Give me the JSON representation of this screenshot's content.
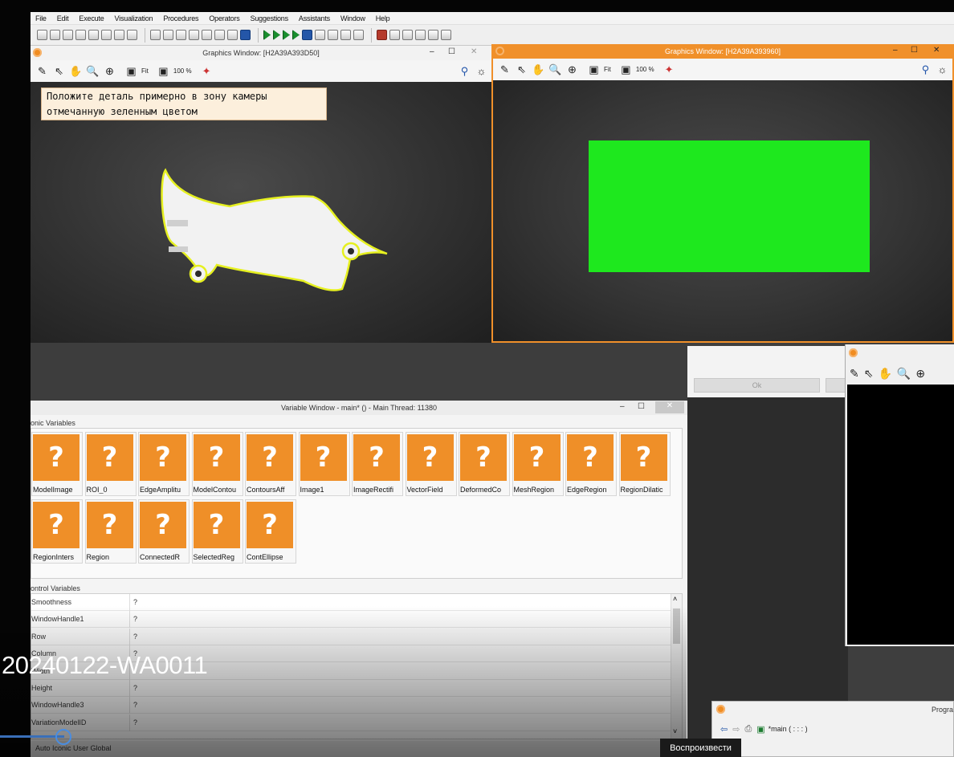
{
  "menu": [
    "File",
    "Edit",
    "Execute",
    "Visualization",
    "Procedures",
    "Operators",
    "Suggestions",
    "Assistants",
    "Window",
    "Help"
  ],
  "graphics_left": {
    "title": "Graphics Window: [H2A39A393D50]",
    "fit_label": "Fit",
    "zoom_label": "100 %",
    "message": "Положите деталь примерно в зону камеры отмечанную зеленным цветом"
  },
  "graphics_right": {
    "title": "Graphics Window: [H2A39A393960]",
    "fit_label": "Fit",
    "zoom_label": "100 %",
    "title_color": "#f0902a"
  },
  "dialog": {
    "ok_label": "Ok"
  },
  "variable_window": {
    "title": "Variable Window - main* () - Main Thread: 11380",
    "iconic_label": "Iconic Variables",
    "iconic_label_visible": "onic Variables",
    "iconic_vars": [
      "ModelImage",
      "ROI_0",
      "EdgeAmplitu",
      "ModelContou",
      "ContoursAff",
      "Image1",
      "ImageRectifi",
      "VectorField",
      "DeformedCo",
      "MeshRegion",
      "EdgeRegion",
      "RegionDilatic",
      "RegionInters",
      "Region",
      "ConnectedR",
      "SelectedReg",
      "ContEllipse"
    ],
    "iconic_value": "?",
    "control_label_visible": "ontrol Variables",
    "control_vars": [
      {
        "name": "Smoothness",
        "value": "?"
      },
      {
        "name": "WindowHandle1",
        "value": "?"
      },
      {
        "name": "Row",
        "value": "?"
      },
      {
        "name": "Column",
        "value": "?"
      },
      {
        "name": "Width",
        "value": ""
      },
      {
        "name": "Height",
        "value": "?"
      },
      {
        "name": "WindowHandle3",
        "value": "?"
      },
      {
        "name": "VariationModelID",
        "value": "?"
      }
    ],
    "tabs_text": "Auto  Iconic  User  Global"
  },
  "program_window": {
    "title": "Progra",
    "combo_text": "*main ( : : : )"
  },
  "video": {
    "title": "20240122-WA0011",
    "play_tooltip": "Воспроизвести",
    "progress_fraction": 0.07
  },
  "colors": {
    "accent_orange": "#f0902a",
    "roi_green": "#1ee81e",
    "contour_yellow": "#e6f020"
  }
}
